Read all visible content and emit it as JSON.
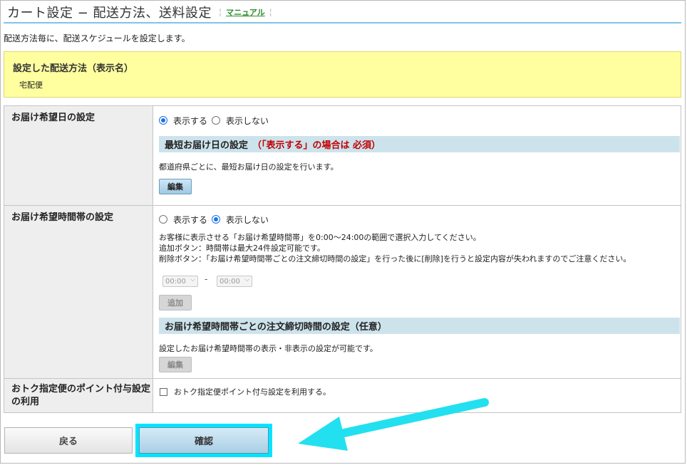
{
  "header": {
    "title": "カート設定 − 配送方法、送料設定",
    "manual_link": "マニュアル"
  },
  "description": "配送方法毎に、配送スケジュールを設定します。",
  "shipping_method": {
    "label": "設定した配送方法（表示名）",
    "value": "宅配便"
  },
  "delivery_date": {
    "label": "お届け希望日の設定",
    "option_show": "表示する",
    "option_hide": "表示しない",
    "selected": "show",
    "subsection_title": "最短お届け日の設定",
    "subsection_required": "（「表示する」の場合は 必須）",
    "subsection_desc": "都道府県ごとに、最短お届け日の設定を行います。",
    "edit_button": "編集"
  },
  "delivery_time": {
    "label": "お届け希望時間帯の設定",
    "option_show": "表示する",
    "option_hide": "表示しない",
    "selected": "hide",
    "notes": [
      "お客様に表示させる「お届け希望時間帯」を0:00〜24:00の範囲で選択入力してください。",
      "追加ボタン：時間帯は最大24件設定可能です。",
      "削除ボタン：「お届け希望時間帯ごとの注文締切時間の設定」を行った後に[削除]を行うと設定内容が失われますのでご注意ください。"
    ],
    "from_time": "00:00",
    "range_separator": "-",
    "to_time": "00:00",
    "add_button": "追加",
    "subsection_title": "お届け希望時間帯ごとの注文締切時間の設定（任意）",
    "subsection_desc": "設定したお届け希望時間帯の表示・非表示の設定が可能です。",
    "edit_button": "編集"
  },
  "points": {
    "label": "おトク指定便のポイント付与設定の利用",
    "checkbox_label": "おトク指定便ポイント付与設定を利用する。",
    "checked": false
  },
  "footer": {
    "back_button": "戻る",
    "confirm_button": "確認"
  },
  "colors": {
    "highlight": "#00e5ff",
    "required_text": "#c00000",
    "subheader_bg": "#cde3ec",
    "notice_bg": "#ffffa0",
    "radio_accent": "#1a73e8"
  }
}
